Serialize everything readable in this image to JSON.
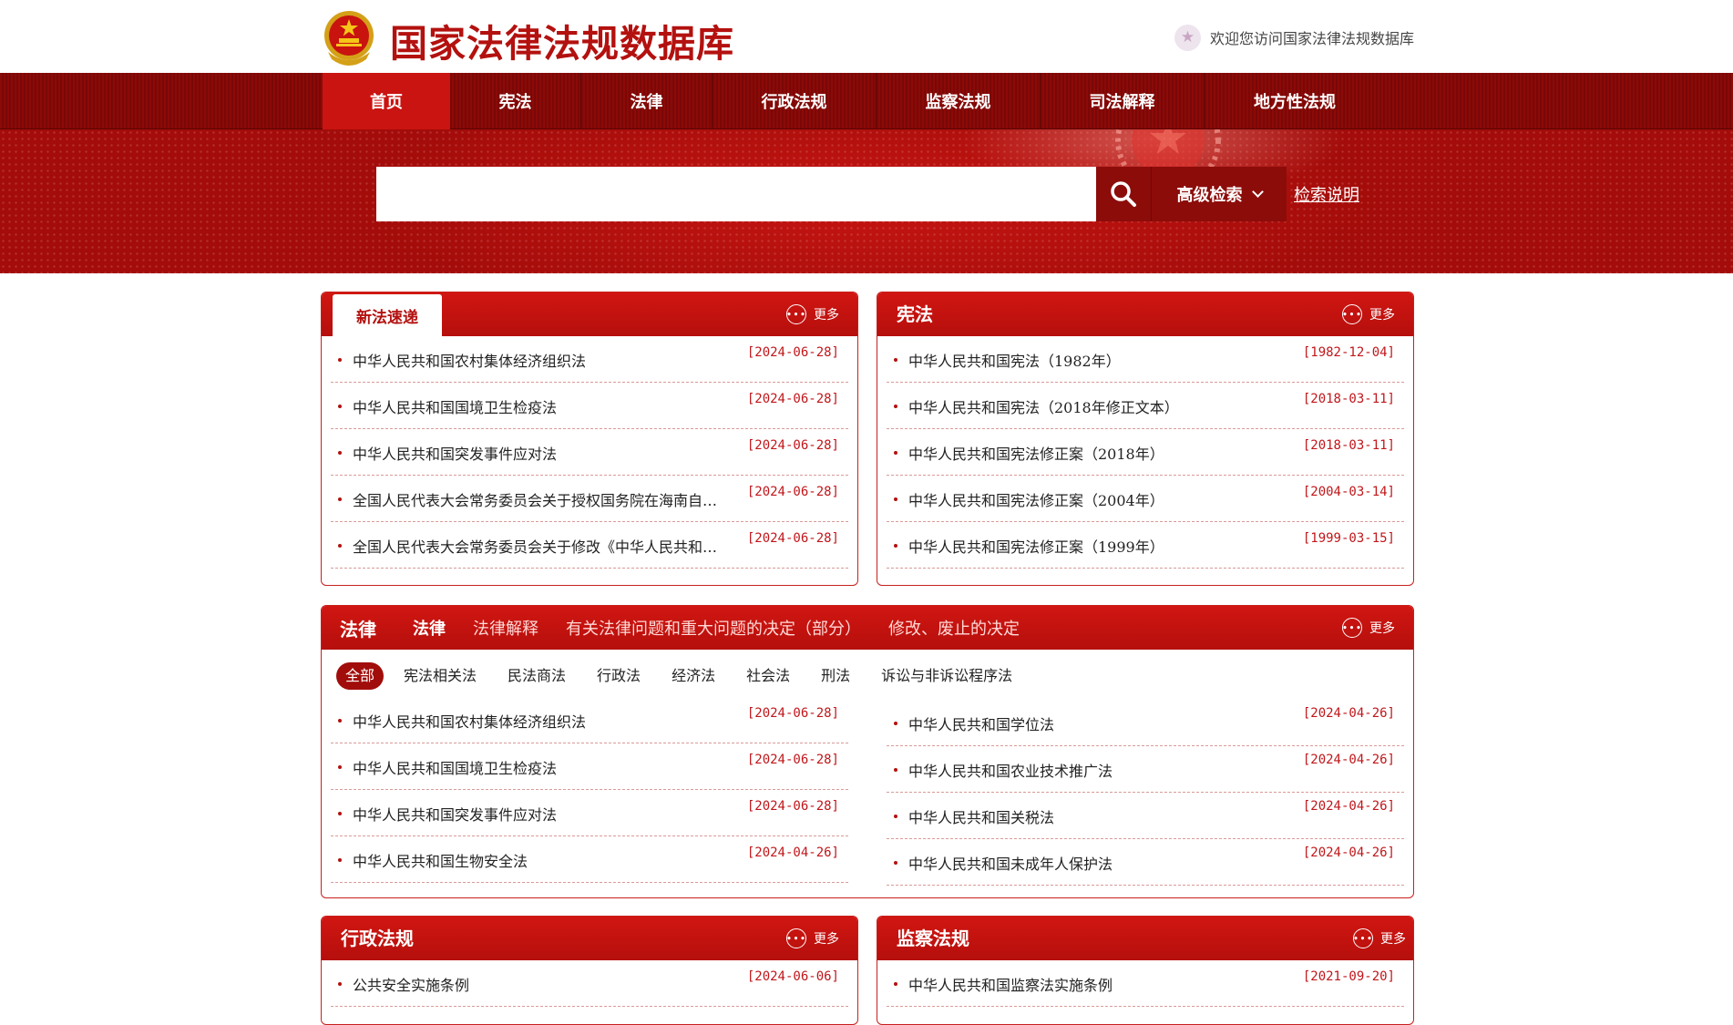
{
  "header": {
    "site_title": "国家法律法规数据库",
    "welcome_text": "欢迎您访问国家法律法规数据库",
    "welcome_icon": "star-badge-icon",
    "logo": "national-emblem-icon"
  },
  "nav": {
    "items": [
      {
        "label": "首页"
      },
      {
        "label": "宪法"
      },
      {
        "label": "法律"
      },
      {
        "label": "行政法规"
      },
      {
        "label": "监察法规"
      },
      {
        "label": "司法解释"
      },
      {
        "label": "地方性法规"
      }
    ],
    "active_index": 0
  },
  "search": {
    "input_value": "",
    "placeholder": "",
    "search_icon": "search-icon",
    "advanced_label": "高级检索",
    "help_label": "检索说明"
  },
  "more_label": "更多",
  "panels": {
    "new_laws": {
      "tab_label": "新法速递",
      "items": [
        {
          "title": "中华人民共和国农村集体经济组织法",
          "date": "[2024-06-28]"
        },
        {
          "title": "中华人民共和国国境卫生检疫法",
          "date": "[2024-06-28]"
        },
        {
          "title": "中华人民共和国突发事件应对法",
          "date": "[2024-06-28]"
        },
        {
          "title": "全国人民代表大会常务委员会关于授权国务院在海南自…",
          "date": "[2024-06-28]"
        },
        {
          "title": "全国人民代表大会常务委员会关于修改《中华人民共和…",
          "date": "[2024-06-28]"
        }
      ]
    },
    "constitution": {
      "title": "宪法",
      "items": [
        {
          "title": "中华人民共和国宪法（1982年）",
          "date": "[1982-12-04]"
        },
        {
          "title": "中华人民共和国宪法（2018年修正文本）",
          "date": "[2018-03-11]"
        },
        {
          "title": "中华人民共和国宪法修正案（2018年）",
          "date": "[2018-03-11]"
        },
        {
          "title": "中华人民共和国宪法修正案（2004年）",
          "date": "[2004-03-14]"
        },
        {
          "title": "中华人民共和国宪法修正案（1999年）",
          "date": "[1999-03-15]"
        }
      ]
    },
    "law": {
      "title": "法律",
      "tabs": [
        "法律",
        "法律解释",
        "有关法律问题和重大问题的决定（部分）",
        "修改、废止的决定"
      ],
      "categories": [
        "全部",
        "宪法相关法",
        "民法商法",
        "行政法",
        "经济法",
        "社会法",
        "刑法",
        "诉讼与非诉讼程序法"
      ],
      "left_items": [
        {
          "title": "中华人民共和国农村集体经济组织法",
          "date": "[2024-06-28]"
        },
        {
          "title": "中华人民共和国国境卫生检疫法",
          "date": "[2024-06-28]"
        },
        {
          "title": "中华人民共和国突发事件应对法",
          "date": "[2024-06-28]"
        },
        {
          "title": "中华人民共和国生物安全法",
          "date": "[2024-04-26]"
        }
      ],
      "right_items": [
        {
          "title": "中华人民共和国学位法",
          "date": "[2024-04-26]"
        },
        {
          "title": "中华人民共和国农业技术推广法",
          "date": "[2024-04-26]"
        },
        {
          "title": "中华人民共和国关税法",
          "date": "[2024-04-26]"
        },
        {
          "title": "中华人民共和国未成年人保护法",
          "date": "[2024-04-26]"
        }
      ]
    },
    "admin": {
      "title": "行政法规",
      "items": [
        {
          "title": "公共安全实施条例",
          "date": "[2024-06-06]"
        }
      ]
    },
    "supervision": {
      "title": "监察法规",
      "items": [
        {
          "title": "中华人民共和国监察法实施条例",
          "date": "[2021-09-20]"
        }
      ]
    }
  },
  "colors": {
    "brand_red": "#b3110f",
    "nav_dark_red": "#8c0a08",
    "active_nav": "#c91411",
    "date_red": "#c0161a"
  }
}
